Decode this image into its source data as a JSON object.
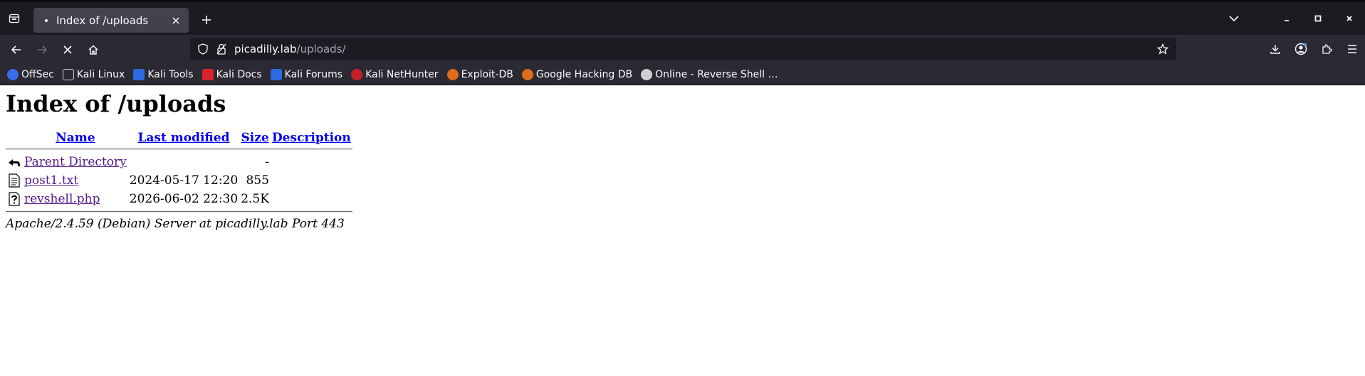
{
  "browser": {
    "tab": {
      "title": "Index of /uploads"
    },
    "url": {
      "host": "picadilly.lab",
      "path": "/uploads/"
    },
    "bookmarks": [
      {
        "label": "OffSec",
        "color": "#3a6ee8"
      },
      {
        "label": "Kali Linux",
        "color": "#2b2a33"
      },
      {
        "label": "Kali Tools",
        "color": "#2b6ae0"
      },
      {
        "label": "Kali Docs",
        "color": "#d8242c"
      },
      {
        "label": "Kali Forums",
        "color": "#2b6ae0"
      },
      {
        "label": "Kali NetHunter",
        "color": "#c8202a"
      },
      {
        "label": "Exploit-DB",
        "color": "#e06a1e"
      },
      {
        "label": "Google Hacking DB",
        "color": "#e06a1e"
      },
      {
        "label": "Online - Reverse Shell …",
        "color": "#d0d0d0"
      }
    ]
  },
  "page": {
    "heading": "Index of /uploads",
    "columns": {
      "name": "Name",
      "modified": "Last modified",
      "size": "Size",
      "description": "Description"
    },
    "rows": [
      {
        "icon": "back-icon",
        "name": "Parent Directory",
        "modified": "",
        "size": "-",
        "description": ""
      },
      {
        "icon": "text-file-icon",
        "name": "post1.txt",
        "modified": "2024-05-17 12:20",
        "size": "855",
        "description": ""
      },
      {
        "icon": "unknown-file-icon",
        "name": "revshell.php",
        "modified": "2026-06-02 22:30",
        "size": "2.5K",
        "description": ""
      }
    ],
    "signature": "Apache/2.4.59 (Debian) Server at picadilly.lab Port 443"
  }
}
